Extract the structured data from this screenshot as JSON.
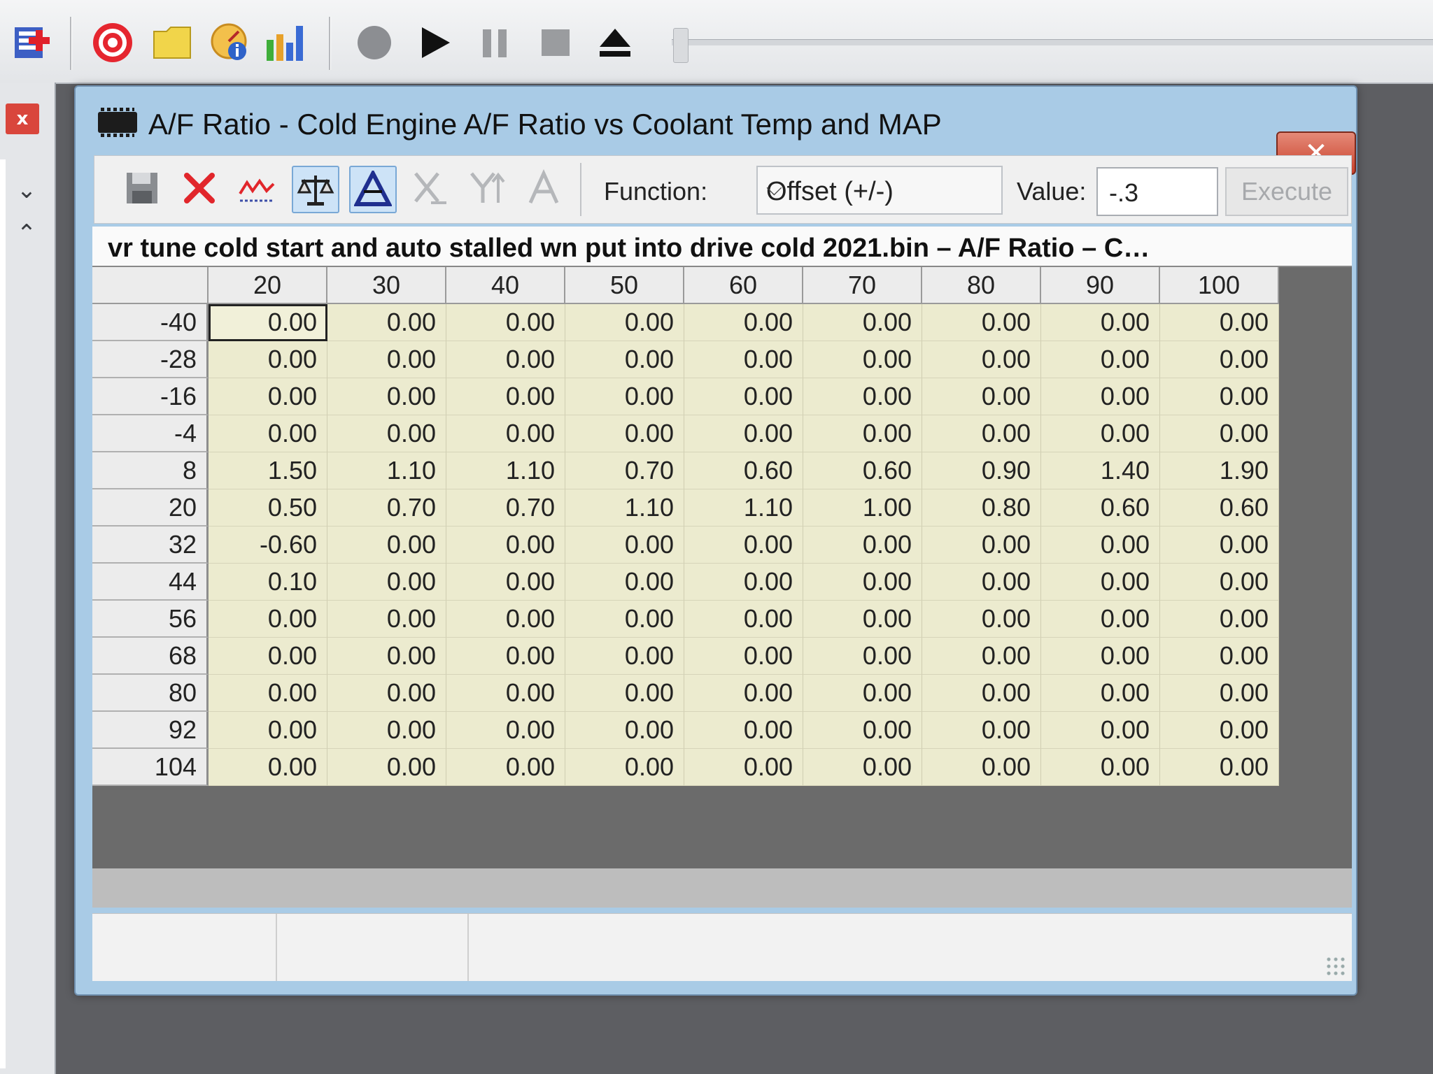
{
  "app_toolbar": {
    "icons": [
      "add-file-icon",
      "record-icon",
      "folder-icon",
      "gauge-info-icon",
      "bar-chart-icon",
      "stop-circle-icon",
      "play-icon",
      "pause-icon",
      "stop-square-icon",
      "eject-icon"
    ]
  },
  "left_panel": {
    "close_label": "x",
    "collapse_glyph": "⌄",
    "expand_glyph": "⌃"
  },
  "window": {
    "title": "A/F Ratio - Cold Engine A/F Ratio vs Coolant Temp and MAP",
    "close_glyph": "✕"
  },
  "toolbar": {
    "function_label": "Function:",
    "function_value": "Offset (+/-)",
    "value_label": "Value:",
    "value": "-.3",
    "execute_label": "Execute"
  },
  "file_caption": "vr tune cold start and auto stalled wn put into drive cold 2021.bin – A/F Ratio – C…",
  "table": {
    "columns": [
      "20",
      "30",
      "40",
      "50",
      "60",
      "70",
      "80",
      "90",
      "100"
    ],
    "rows": [
      {
        "label": "-40",
        "values": [
          "0.00",
          "0.00",
          "0.00",
          "0.00",
          "0.00",
          "0.00",
          "0.00",
          "0.00",
          "0.00"
        ]
      },
      {
        "label": "-28",
        "values": [
          "0.00",
          "0.00",
          "0.00",
          "0.00",
          "0.00",
          "0.00",
          "0.00",
          "0.00",
          "0.00"
        ]
      },
      {
        "label": "-16",
        "values": [
          "0.00",
          "0.00",
          "0.00",
          "0.00",
          "0.00",
          "0.00",
          "0.00",
          "0.00",
          "0.00"
        ]
      },
      {
        "label": "-4",
        "values": [
          "0.00",
          "0.00",
          "0.00",
          "0.00",
          "0.00",
          "0.00",
          "0.00",
          "0.00",
          "0.00"
        ]
      },
      {
        "label": "8",
        "values": [
          "1.50",
          "1.10",
          "1.10",
          "0.70",
          "0.60",
          "0.60",
          "0.90",
          "1.40",
          "1.90"
        ]
      },
      {
        "label": "20",
        "values": [
          "0.50",
          "0.70",
          "0.70",
          "1.10",
          "1.10",
          "1.00",
          "0.80",
          "0.60",
          "0.60"
        ]
      },
      {
        "label": "32",
        "values": [
          "-0.60",
          "0.00",
          "0.00",
          "0.00",
          "0.00",
          "0.00",
          "0.00",
          "0.00",
          "0.00"
        ]
      },
      {
        "label": "44",
        "values": [
          "0.10",
          "0.00",
          "0.00",
          "0.00",
          "0.00",
          "0.00",
          "0.00",
          "0.00",
          "0.00"
        ]
      },
      {
        "label": "56",
        "values": [
          "0.00",
          "0.00",
          "0.00",
          "0.00",
          "0.00",
          "0.00",
          "0.00",
          "0.00",
          "0.00"
        ]
      },
      {
        "label": "68",
        "values": [
          "0.00",
          "0.00",
          "0.00",
          "0.00",
          "0.00",
          "0.00",
          "0.00",
          "0.00",
          "0.00"
        ]
      },
      {
        "label": "80",
        "values": [
          "0.00",
          "0.00",
          "0.00",
          "0.00",
          "0.00",
          "0.00",
          "0.00",
          "0.00",
          "0.00"
        ]
      },
      {
        "label": "92",
        "values": [
          "0.00",
          "0.00",
          "0.00",
          "0.00",
          "0.00",
          "0.00",
          "0.00",
          "0.00",
          "0.00"
        ]
      },
      {
        "label": "104",
        "values": [
          "0.00",
          "0.00",
          "0.00",
          "0.00",
          "0.00",
          "0.00",
          "0.00",
          "0.00",
          "0.00"
        ]
      }
    ]
  },
  "colors": {
    "cell_background": "#ecebcf",
    "header_background": "#ececec",
    "window_frame": "#a9cbe6",
    "close_button": "#c8402b"
  }
}
